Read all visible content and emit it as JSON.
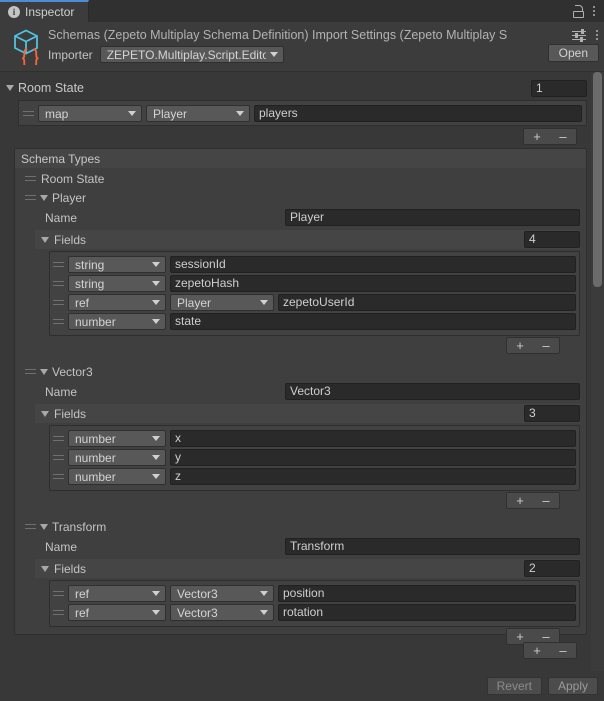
{
  "window": {
    "tab_label": "Inspector",
    "tab_icon": "info-icon",
    "lock_icon": "lock-icon",
    "menu_icon": "kebab-menu-icon"
  },
  "asset": {
    "icon": "script-cube-icon",
    "title": "Schemas (Zepeto Multiplay Schema Definition) Import Settings (Zepeto Multiplay S",
    "preset_icon": "preset-settings-icon",
    "menu_icon": "kebab-menu-icon",
    "importer_label": "Importer",
    "importer_value": "ZEPETO.Multiplay.Script.Editor.Z",
    "open_button": "Open"
  },
  "room_state": {
    "label": "Room State",
    "count": "1",
    "entry": {
      "collection_type": "map",
      "value_type": "Player",
      "name": "players"
    },
    "add_label": "+",
    "remove_label": "–"
  },
  "schema_types": {
    "header": "Schema Types",
    "root_entry": "Room State",
    "add_label": "+",
    "remove_label": "–",
    "name_label": "Name",
    "fields_label": "Fields",
    "types": [
      {
        "title": "Player",
        "name": "Player",
        "field_count": "4",
        "fields": [
          {
            "type": "string",
            "ref": null,
            "name": "sessionId"
          },
          {
            "type": "string",
            "ref": null,
            "name": "zepetoHash"
          },
          {
            "type": "ref",
            "ref": "Player",
            "name": "zepetoUserId"
          },
          {
            "type": "number",
            "ref": null,
            "name": "state"
          }
        ]
      },
      {
        "title": "Vector3",
        "name": "Vector3",
        "field_count": "3",
        "fields": [
          {
            "type": "number",
            "ref": null,
            "name": "x"
          },
          {
            "type": "number",
            "ref": null,
            "name": "y"
          },
          {
            "type": "number",
            "ref": null,
            "name": "z"
          }
        ]
      },
      {
        "title": "Transform",
        "name": "Transform",
        "field_count": "2",
        "fields": [
          {
            "type": "ref",
            "ref": "Vector3",
            "name": "position"
          },
          {
            "type": "ref",
            "ref": "Vector3",
            "name": "rotation"
          }
        ]
      }
    ]
  },
  "footer": {
    "revert_label": "Revert",
    "apply_label": "Apply"
  },
  "colors": {
    "tab_accent": "#4a8ed8",
    "panel_bg": "#383838",
    "header_bg": "#3c3c3c",
    "field_bg": "#2a2a2a",
    "dropdown_bg": "#585858",
    "icon_cube": "#4ec3e0",
    "icon_braces": "#f4633a"
  }
}
